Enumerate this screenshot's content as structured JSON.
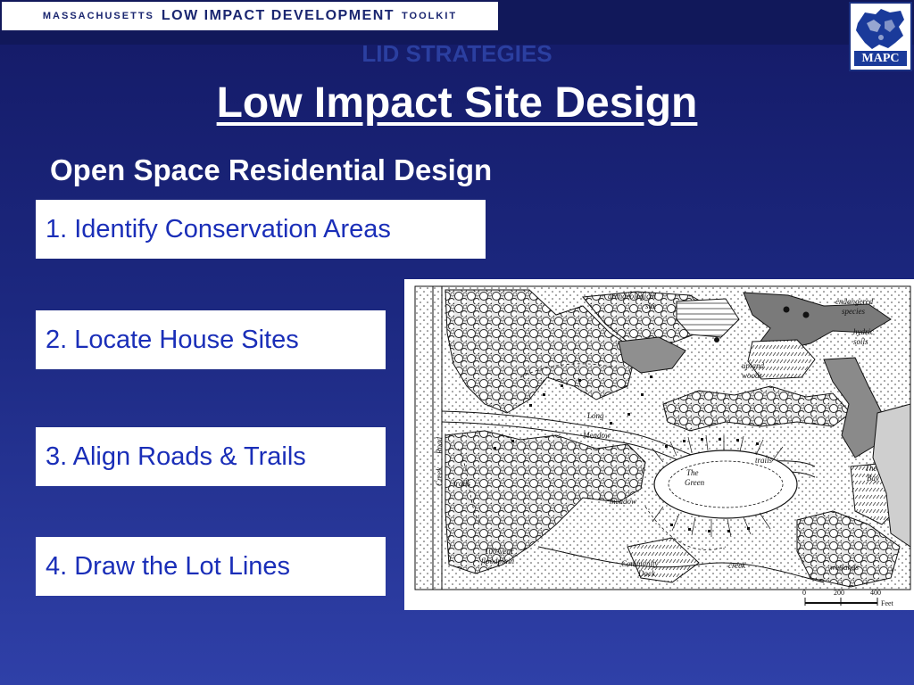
{
  "banner": {
    "prefix": "MASSACHUSETTS",
    "main": "LOW IMPACT DEVELOPMENT",
    "suffix": "TOOLKIT"
  },
  "logo": {
    "text": "MAPC"
  },
  "slide": {
    "kicker": "LID STRATEGIES",
    "title": "Low Impact Site Design",
    "subtitle": "Open Space Residential Design",
    "steps": [
      "1. Identify Conservation Areas",
      "2. Locate House Sites",
      "3. Align Roads & Trails",
      "4. Draw the Lot Lines"
    ]
  },
  "map": {
    "labels": {
      "archaeological": "archaeological",
      "site": "site",
      "endangered": "endangered",
      "species": "species",
      "hydric": "hydric",
      "soils": "soils",
      "upland": "upland",
      "woods": "woods",
      "long": "Long",
      "meadow_upper": "Meadow",
      "trails_right": "trails",
      "the_green_1": "The",
      "the_green_2": "Green",
      "the_bay_1": "The",
      "the_bay_2": "Bay",
      "creek_road_1": "Creek",
      "creek_road_2": "Road",
      "trails_left": "trails",
      "meadow_lower": "meadow",
      "wetlands": "wetlands",
      "floodplain_1": "100-year",
      "floodplain_2": "floodplain",
      "community": "Community",
      "dock": "Dock",
      "creek": "creek"
    },
    "scale": {
      "ticks": [
        "0",
        "200",
        "400"
      ],
      "unit": "Feet"
    }
  },
  "colors": {
    "background_top": "#141a66",
    "background_bottom": "#2f40a8",
    "step_text": "#1a2eb8",
    "kicker_text": "#2b3fa0"
  }
}
